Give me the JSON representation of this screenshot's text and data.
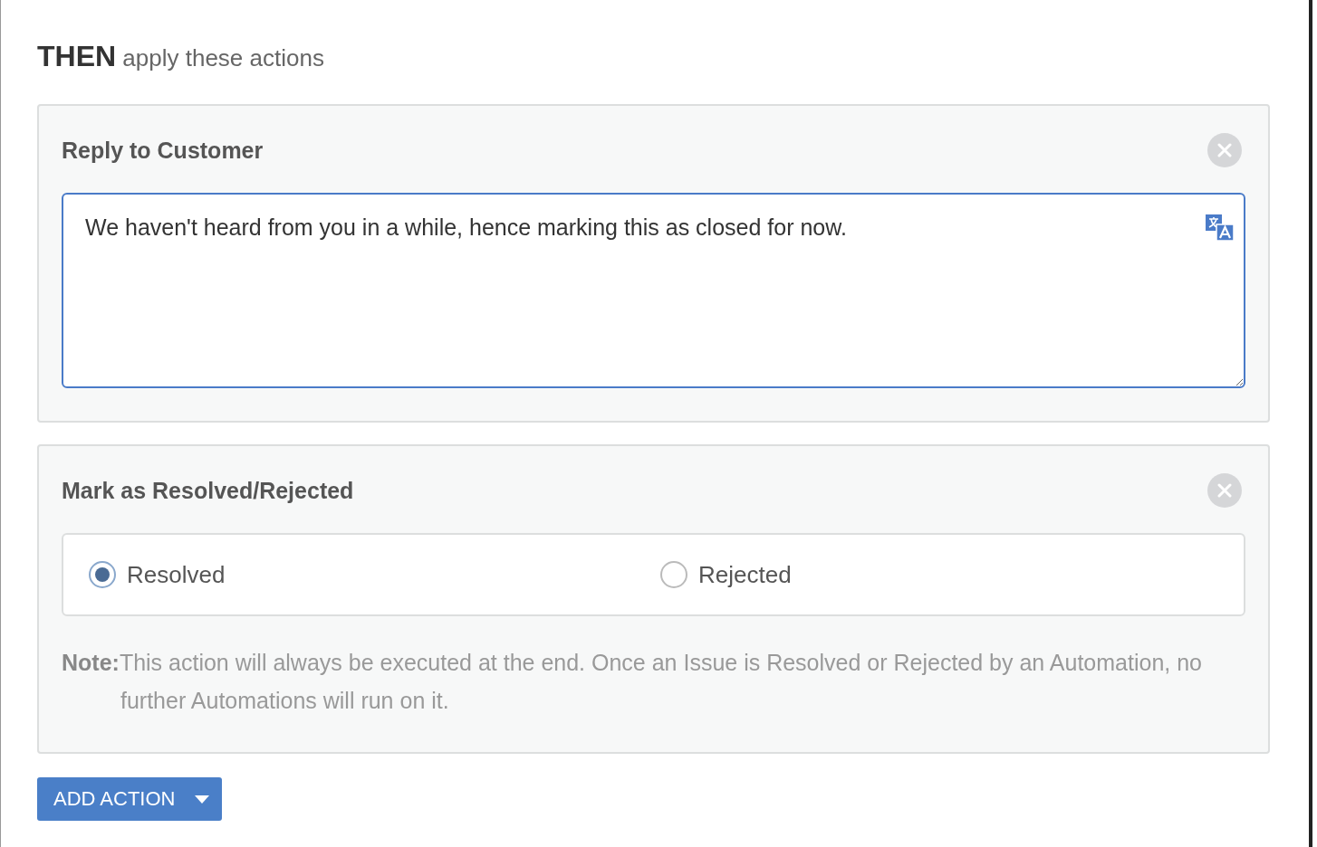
{
  "heading": "**THEN** apply these actions",
  "reply_card": {
    "title": "Reply to Customer",
    "message": "We haven't heard from you in a while, hence marking this as closed for now."
  },
  "status_card": {
    "title": "Mark as Resolved/Rejected",
    "options": [
      {
        "label": "Resolved",
        "selected": true
      },
      {
        "label": "Rejected",
        "selected": false
      }
    ],
    "note": "**Note:**This action will always be executed at the end. Once an Issue is Resolved or Rejected by an Automation, no further Automations will run on it."
  },
  "add_button": "ADD ACTION"
}
